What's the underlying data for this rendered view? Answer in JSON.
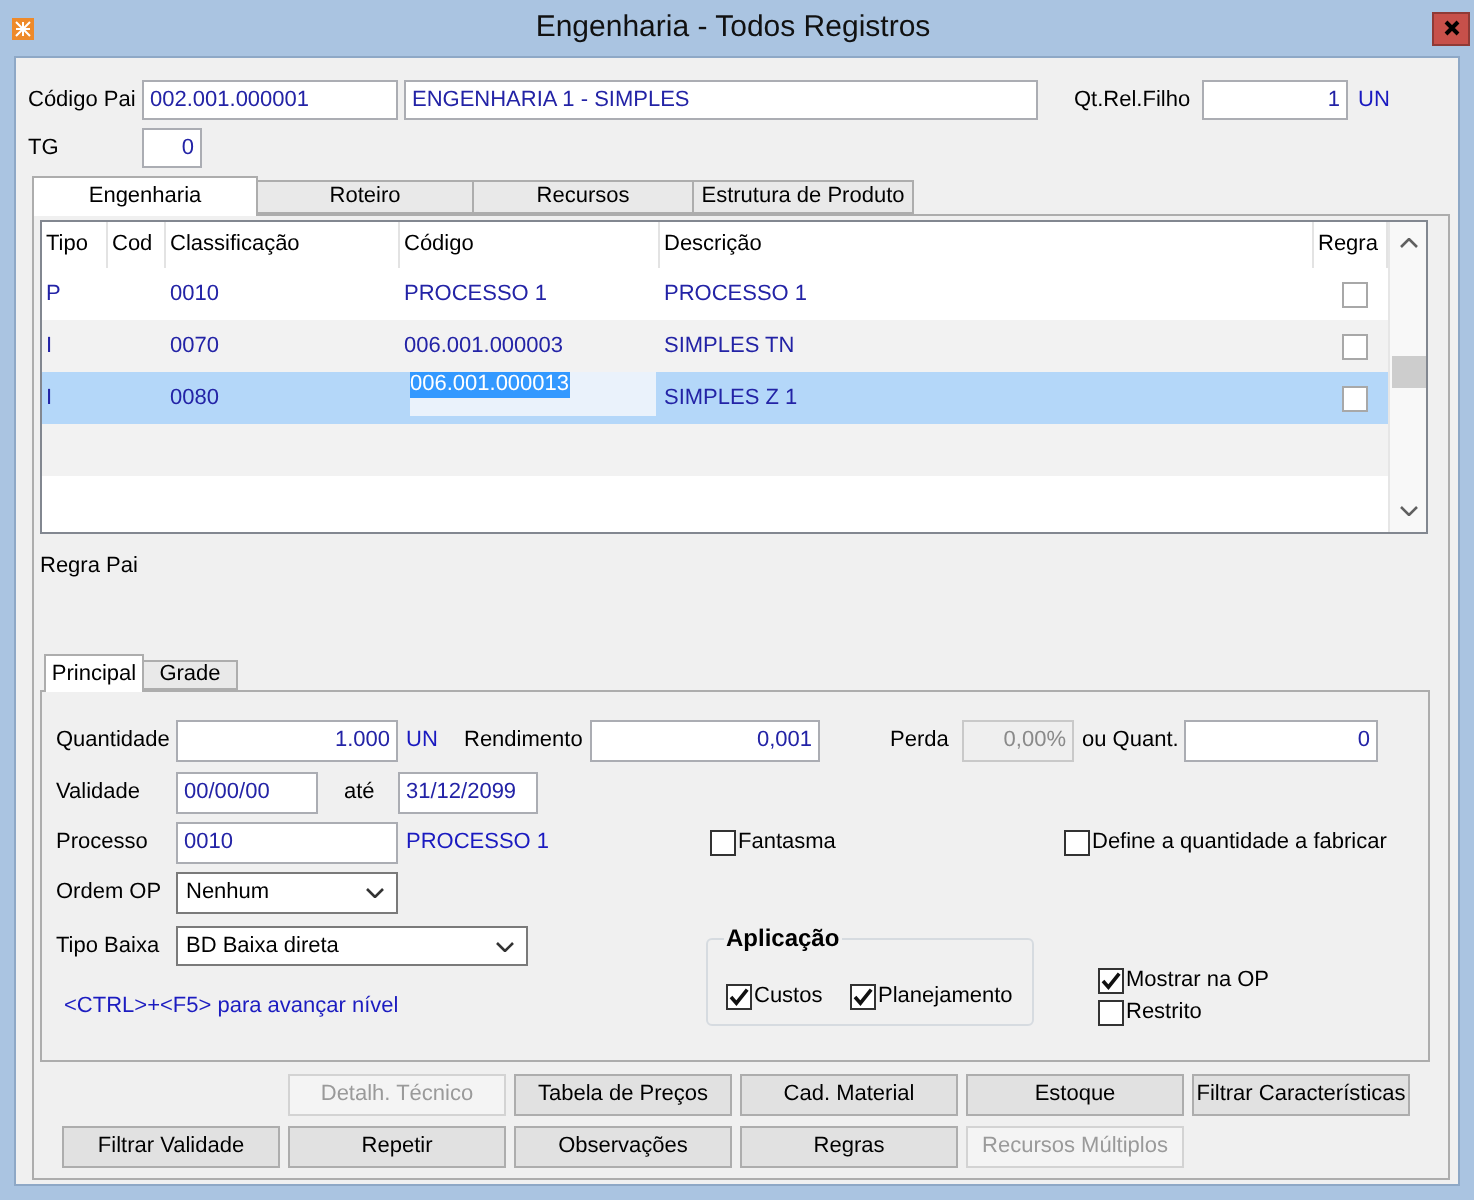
{
  "window": {
    "title": "Engenharia - Todos Registros"
  },
  "header": {
    "codigo_pai": {
      "label": "Código Pai",
      "value": "002.001.000001",
      "description": "ENGENHARIA 1 - SIMPLES"
    },
    "qt_rel_filho": {
      "label": "Qt.Rel.Filho",
      "value": "1",
      "unit": "UN"
    },
    "tg": {
      "label": "TG",
      "value": "0"
    }
  },
  "tabs": [
    {
      "label": "Engenharia",
      "selected": true
    },
    {
      "label": "Roteiro",
      "selected": false
    },
    {
      "label": "Recursos",
      "selected": false
    },
    {
      "label": "Estrutura de Produto",
      "selected": false
    }
  ],
  "grid": {
    "columns": [
      "Tipo",
      "Cod",
      "Classificação",
      "Código",
      "Descrição",
      "Regra"
    ],
    "rows": [
      {
        "tipo": "P",
        "classificacao": "0010",
        "codigo": "PROCESSO 1",
        "descricao": "PROCESSO 1",
        "regra": false,
        "selected": false,
        "editing": false
      },
      {
        "tipo": "I",
        "classificacao": "0070",
        "codigo": "006.001.000003",
        "descricao": "SIMPLES TN",
        "regra": false,
        "selected": false,
        "editing": false
      },
      {
        "tipo": "I",
        "classificacao": "0080",
        "codigo": "006.001.000013",
        "descricao": "SIMPLES Z 1",
        "regra": false,
        "selected": true,
        "editing": true
      }
    ]
  },
  "regra_pai": {
    "label": "Regra Pai"
  },
  "sub_tabs": [
    {
      "label": "Principal",
      "selected": true
    },
    {
      "label": "Grade",
      "selected": false
    }
  ],
  "form": {
    "quantidade": {
      "label": "Quantidade",
      "value": "1.000",
      "unit": "UN"
    },
    "rendimento": {
      "label": "Rendimento",
      "value": "0,001"
    },
    "perda": {
      "label": "Perda",
      "value": "0,00%",
      "disabled": true
    },
    "ou_quant": {
      "label": "ou Quant.",
      "value": "0"
    },
    "validade": {
      "label": "Validade",
      "value": "00/00/00"
    },
    "ate": {
      "label": "até",
      "value": "31/12/2099"
    },
    "processo": {
      "label": "Processo",
      "value": "0010",
      "description": "PROCESSO 1"
    },
    "fantasma": {
      "label": "Fantasma",
      "checked": false
    },
    "define_quantidade": {
      "label": "Define a quantidade a fabricar",
      "checked": false
    },
    "ordem_op": {
      "label": "Ordem OP",
      "value": "Nenhum"
    },
    "tipo_baixa": {
      "label": "Tipo Baixa",
      "value": "BD Baixa direta"
    },
    "hint": "<CTRL>+<F5> para avançar nível",
    "aplicacao": {
      "title": "Aplicação",
      "options": [
        {
          "label": "Custos",
          "checked": true
        },
        {
          "label": "Planejamento",
          "checked": true
        }
      ]
    },
    "options": [
      {
        "label": "Mostrar na OP",
        "checked": true
      },
      {
        "label": "Restrito",
        "checked": false
      }
    ]
  },
  "button_rows": [
    {
      "buttons": [
        {
          "label": "Detalh. Técnico",
          "disabled": true
        },
        {
          "label": "Tabela de Preços",
          "disabled": false
        },
        {
          "label": "Cad. Material",
          "disabled": false
        },
        {
          "label": "Estoque",
          "disabled": false
        },
        {
          "label": "Filtrar Características",
          "disabled": false
        }
      ]
    },
    {
      "buttons": [
        {
          "label": "Filtrar Validade",
          "disabled": false
        },
        {
          "label": "Repetir",
          "disabled": false
        },
        {
          "label": "Observações",
          "disabled": false
        },
        {
          "label": "Regras",
          "disabled": false
        },
        {
          "label": "Recursos Múltiplos",
          "disabled": true
        }
      ]
    }
  ]
}
